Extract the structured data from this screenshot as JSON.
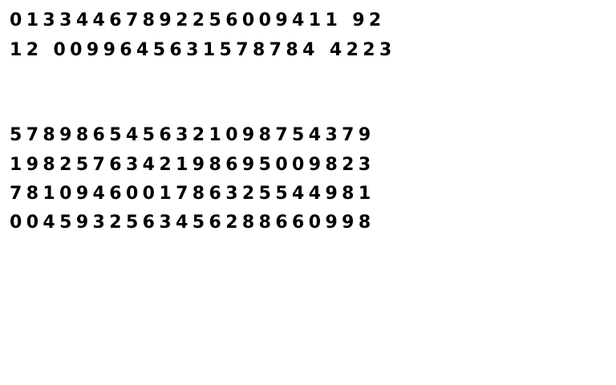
{
  "block_one": [
    "01334467892256009411 92",
    "12 0099645631578784 4223"
  ],
  "block_two": [
    "5789865456321098754379",
    "1982576342198695009823",
    "7810946001786325544981",
    "0045932563456288660998"
  ]
}
